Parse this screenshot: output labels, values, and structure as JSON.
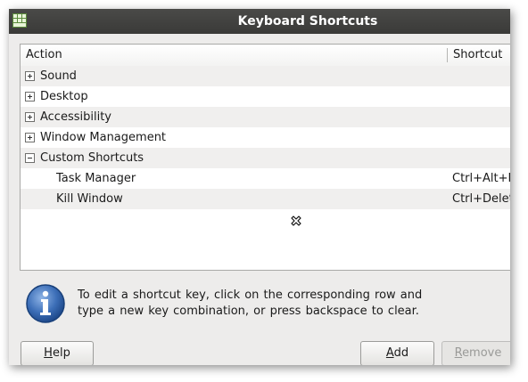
{
  "window": {
    "title": "Keyboard Shortcuts"
  },
  "tree": {
    "headers": {
      "action": "Action",
      "shortcut": "Shortcut"
    },
    "rows": [
      {
        "label": "Sound",
        "shortcut": "",
        "expander": "plus",
        "depth": 0
      },
      {
        "label": "Desktop",
        "shortcut": "",
        "expander": "plus",
        "depth": 0
      },
      {
        "label": "Accessibility",
        "shortcut": "",
        "expander": "plus",
        "depth": 0
      },
      {
        "label": "Window Management",
        "shortcut": "",
        "expander": "plus",
        "depth": 0
      },
      {
        "label": "Custom Shortcuts",
        "shortcut": "",
        "expander": "minus",
        "depth": 0
      },
      {
        "label": "Task Manager",
        "shortcut": "Ctrl+Alt+E",
        "expander": "none",
        "depth": 1
      },
      {
        "label": "Kill Window",
        "shortcut": "Ctrl+Delete",
        "expander": "none",
        "depth": 1
      }
    ]
  },
  "info": {
    "icon": "info-icon",
    "line1": "To edit a shortcut key, click on the corresponding row and",
    "line2": "type a new key combination, or press backspace to clear."
  },
  "buttons": {
    "help": {
      "prefix": "",
      "mnemonic": "H",
      "rest": "elp"
    },
    "add": {
      "prefix": "",
      "mnemonic": "A",
      "rest": "dd"
    },
    "remove": {
      "prefix": "",
      "mnemonic": "R",
      "rest": "emove",
      "disabled": true
    }
  }
}
